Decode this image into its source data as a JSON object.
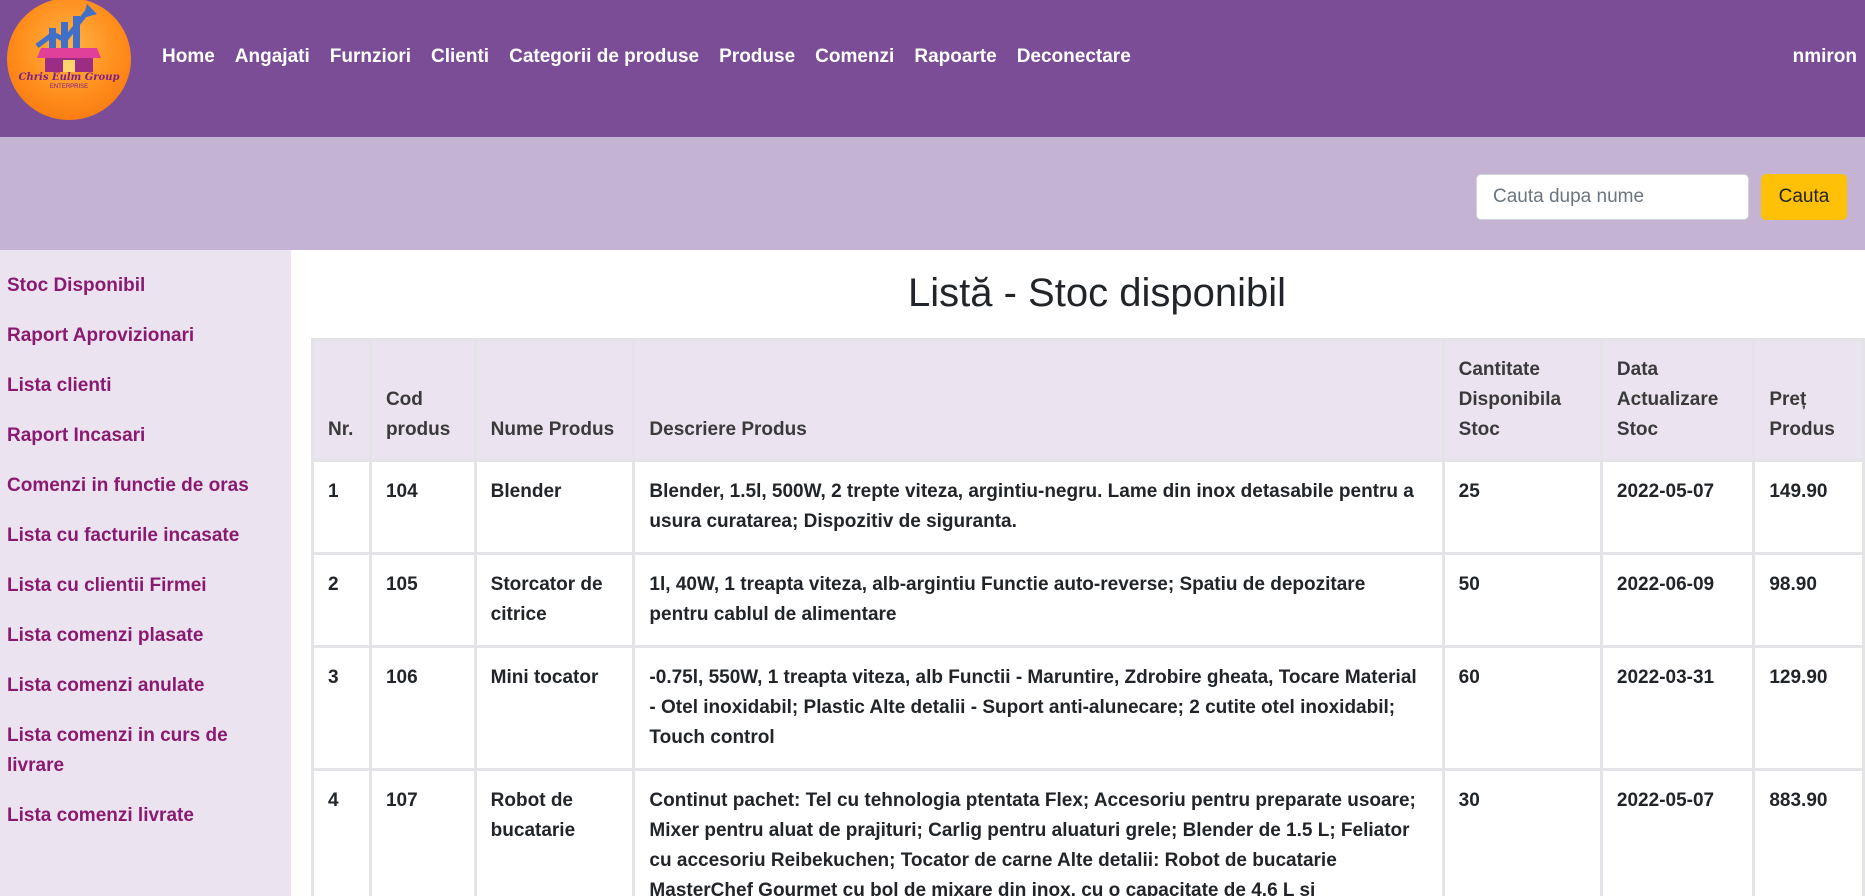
{
  "brand": {
    "logo_text": "Chris Eulm Group",
    "logo_sub": "ENTERPRISE"
  },
  "nav": {
    "items": [
      "Home",
      "Angajati",
      "Furnziori",
      "Clienti",
      "Categorii de produse",
      "Produse",
      "Comenzi",
      "Rapoarte",
      "Deconectare"
    ],
    "user": "nmiron"
  },
  "search": {
    "placeholder": "Cauta dupa nume",
    "button_label": "Cauta"
  },
  "sidebar": {
    "items": [
      "Stoc Disponibil",
      "Raport Aprovizionari",
      "Lista clienti",
      "Raport Incasari",
      "Comenzi in functie de oras",
      "Lista cu facturile incasate",
      "Lista cu clientii Firmei",
      "Lista comenzi plasate",
      "Lista comenzi anulate",
      "Lista comenzi in curs de livrare",
      "Lista comenzi livrate"
    ]
  },
  "page": {
    "title": "Listă - Stoc disponibil"
  },
  "table": {
    "headers": [
      "Nr.",
      "Cod produs",
      "Nume Produs",
      "Descriere Produs",
      "Cantitate Disponibila Stoc",
      "Data Actualizare Stoc",
      "Preț Produs"
    ],
    "rows": [
      [
        "1",
        "104",
        "Blender",
        "Blender, 1.5l, 500W, 2 trepte viteza, argintiu-negru. Lame din inox detasabile pentru a usura curatarea; Dispozitiv de siguranta.",
        "25",
        "2022-05-07",
        "149.90"
      ],
      [
        "2",
        "105",
        "Storcator de citrice",
        "1l, 40W, 1 treapta viteza, alb-argintiu Functie auto-reverse; Spatiu de depozitare pentru cablul de alimentare",
        "50",
        "2022-06-09",
        "98.90"
      ],
      [
        "3",
        "106",
        "Mini tocator",
        "-0.75l, 550W, 1 treapta viteza, alb Functii - Maruntire, Zdrobire gheata, Tocare Material - Otel inoxidabil; Plastic Alte detalii - Suport anti-alunecare; 2 cutite otel inoxidabil; Touch control",
        "60",
        "2022-03-31",
        "129.90"
      ],
      [
        "4",
        "107",
        "Robot de bucatarie",
        "Continut pachet: Tel cu tehnologia ptentata Flex; Accesoriu pentru preparate usoare; Mixer pentru aluat de prajituri; Carlig pentru aluaturi grele; Blender de 1.5 L; Feliator cu accesoriu Reibekuchen; Tocator de carne Alte detalii: Robot de bucatarie MasterChef Gourmet cu bol de mixare din inox, cu o capacitate de 4.6 L si",
        "30",
        "2022-05-07",
        "883.90"
      ]
    ]
  },
  "colors": {
    "navbar": "#7a4d96",
    "searchbar": "#c5b3d3",
    "sidebar": "#ebe4f0",
    "sidebar_link": "#8a1a70",
    "search_button": "#ffc107"
  }
}
